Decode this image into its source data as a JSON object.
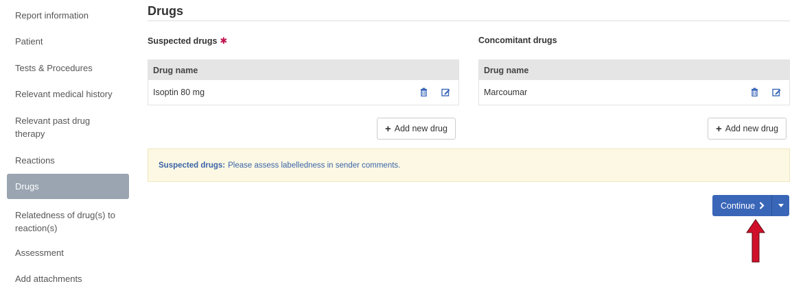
{
  "sidebar": {
    "items": [
      {
        "label": "Report information"
      },
      {
        "label": "Patient"
      },
      {
        "label": "Tests & Procedures"
      },
      {
        "label": "Relevant medical history"
      },
      {
        "label": "Relevant past drug therapy"
      },
      {
        "label": "Reactions"
      },
      {
        "label": "Drugs",
        "active": true
      },
      {
        "label": "Relatedness of drug(s) to reaction(s)"
      },
      {
        "label": "Assessment"
      },
      {
        "label": "Add attachments"
      }
    ]
  },
  "main": {
    "title": "Drugs",
    "suspected": {
      "label": "Suspected drugs",
      "required_mark": "✱",
      "column_header": "Drug name",
      "rows": [
        {
          "name": "Isoptin 80 mg"
        }
      ],
      "add_label": "Add new drug"
    },
    "concomitant": {
      "label": "Concomitant drugs",
      "column_header": "Drug name",
      "rows": [
        {
          "name": "Marcoumar"
        }
      ],
      "add_label": "Add new drug"
    },
    "alert": {
      "strong": "Suspected drugs:",
      "text": "Please assess labelledness in sender comments."
    },
    "continue_label": "Continue"
  },
  "colors": {
    "accent": "#3a66b8",
    "sidebar_active": "#9aa5b1",
    "required": "#c0134d",
    "alert_bg": "#fcf8e3",
    "alert_text": "#3a63a8",
    "annotation_arrow": "#d0102a"
  },
  "icons": [
    "trash-icon",
    "edit-icon",
    "plus-icon",
    "chevron-right-icon",
    "caret-down-icon",
    "up-arrow-icon"
  ]
}
